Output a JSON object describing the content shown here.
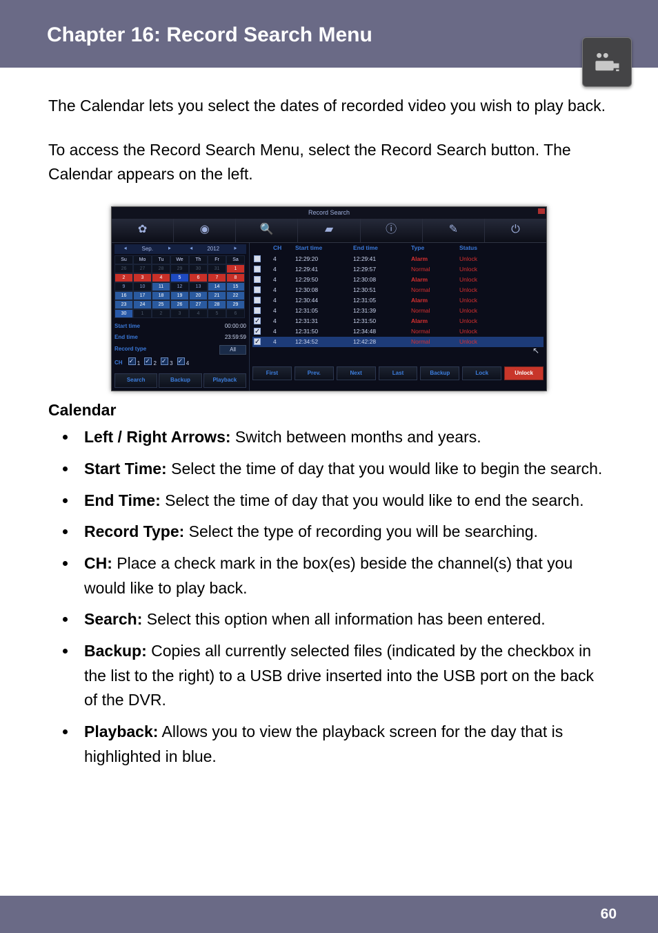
{
  "header": {
    "title": "Chapter 16: Record Search Menu",
    "icon": "recorder-icon"
  },
  "intro1": "The Calendar lets you select the dates of recorded video you wish to play back.",
  "intro2": "To access the Record Search Menu, select the Record Search button. The Calendar appears on the left.",
  "screenshot": {
    "title": "Record Search",
    "month_label": "Sep.",
    "year_label": "2012",
    "day_headers": [
      "Su",
      "Mo",
      "Tu",
      "We",
      "Th",
      "Fr",
      "Sa"
    ],
    "cal": [
      [
        {
          "d": "26",
          "c": "muted"
        },
        {
          "d": "27",
          "c": "muted"
        },
        {
          "d": "28",
          "c": "muted"
        },
        {
          "d": "29",
          "c": "muted"
        },
        {
          "d": "30",
          "c": "muted"
        },
        {
          "d": "31",
          "c": "muted"
        },
        {
          "d": "1",
          "c": "red"
        }
      ],
      [
        {
          "d": "2",
          "c": "red"
        },
        {
          "d": "3",
          "c": "red"
        },
        {
          "d": "4",
          "c": "red"
        },
        {
          "d": "5",
          "c": "blue"
        },
        {
          "d": "6",
          "c": "red"
        },
        {
          "d": "7",
          "c": "red"
        },
        {
          "d": "8",
          "c": "red"
        }
      ],
      [
        {
          "d": "9",
          "c": ""
        },
        {
          "d": "10",
          "c": ""
        },
        {
          "d": "11",
          "c": "mid"
        },
        {
          "d": "12",
          "c": ""
        },
        {
          "d": "13",
          "c": ""
        },
        {
          "d": "14",
          "c": "mid"
        },
        {
          "d": "15",
          "c": "mid"
        }
      ],
      [
        {
          "d": "16",
          "c": "mid"
        },
        {
          "d": "17",
          "c": "mid"
        },
        {
          "d": "18",
          "c": "mid"
        },
        {
          "d": "19",
          "c": "mid"
        },
        {
          "d": "20",
          "c": "mid"
        },
        {
          "d": "21",
          "c": "mid"
        },
        {
          "d": "22",
          "c": "mid"
        }
      ],
      [
        {
          "d": "23",
          "c": "mid"
        },
        {
          "d": "24",
          "c": "mid"
        },
        {
          "d": "25",
          "c": "mid"
        },
        {
          "d": "26",
          "c": "mid"
        },
        {
          "d": "27",
          "c": "mid"
        },
        {
          "d": "28",
          "c": "mid"
        },
        {
          "d": "29",
          "c": "mid"
        }
      ],
      [
        {
          "d": "30",
          "c": "hili"
        },
        {
          "d": "1",
          "c": "muted"
        },
        {
          "d": "2",
          "c": "muted"
        },
        {
          "d": "3",
          "c": "muted"
        },
        {
          "d": "4",
          "c": "muted"
        },
        {
          "d": "5",
          "c": "muted"
        },
        {
          "d": "6",
          "c": "muted"
        }
      ]
    ],
    "left": {
      "start_time_label": "Start time",
      "start_time_value": "00:00:00",
      "end_time_label": "End time",
      "end_time_value": "23:59:59",
      "record_type_label": "Record type",
      "record_type_value": "All",
      "ch_label": "CH",
      "ch_boxes": [
        "1",
        "2",
        "3",
        "4"
      ],
      "buttons": [
        "Search",
        "Backup",
        "Playback"
      ]
    },
    "table": {
      "headers": [
        "",
        "CH",
        "Start time",
        "End time",
        "Type",
        "Status"
      ],
      "rows": [
        {
          "ck": false,
          "ch": "4",
          "st": "12:29:20",
          "et": "12:29:41",
          "ty": "Alarm",
          "tyc": "ty-red",
          "ss": "Unlock"
        },
        {
          "ck": false,
          "ch": "4",
          "st": "12:29:41",
          "et": "12:29:57",
          "ty": "Normal",
          "tyc": "ty-norm",
          "ss": "Unlock"
        },
        {
          "ck": false,
          "ch": "4",
          "st": "12:29:50",
          "et": "12:30:08",
          "ty": "Alarm",
          "tyc": "ty-red",
          "ss": "Unlock"
        },
        {
          "ck": false,
          "ch": "4",
          "st": "12:30:08",
          "et": "12:30:51",
          "ty": "Normal",
          "tyc": "ty-norm",
          "ss": "Unlock"
        },
        {
          "ck": false,
          "ch": "4",
          "st": "12:30:44",
          "et": "12:31:05",
          "ty": "Alarm",
          "tyc": "ty-red",
          "ss": "Unlock"
        },
        {
          "ck": false,
          "ch": "4",
          "st": "12:31:05",
          "et": "12:31:39",
          "ty": "Normal",
          "tyc": "ty-norm",
          "ss": "Unlock"
        },
        {
          "ck": true,
          "ch": "4",
          "st": "12:31:31",
          "et": "12:31:50",
          "ty": "Alarm",
          "tyc": "ty-red",
          "ss": "Unlock"
        },
        {
          "ck": true,
          "ch": "4",
          "st": "12:31:50",
          "et": "12:34:48",
          "ty": "Normal",
          "tyc": "ty-norm",
          "ss": "Unlock"
        },
        {
          "ck": true,
          "ch": "4",
          "st": "12:34:52",
          "et": "12:42:28",
          "ty": "Normal",
          "tyc": "ty-norm",
          "ss": "Unlock",
          "sel": true
        }
      ],
      "buttons": [
        "First",
        "Prev.",
        "Next",
        "Last",
        "Backup",
        "Lock",
        "Unlock"
      ]
    }
  },
  "calendar_heading": "Calendar",
  "bullets": [
    {
      "b": "Left / Right Arrows:",
      "t": " Switch between months and years."
    },
    {
      "b": "Start Time:",
      "t": " Select the time of day that you would like to begin the search."
    },
    {
      "b": "End Time:",
      "t": " Select the time of day that you would like to end the search."
    },
    {
      "b": "Record Type:",
      "t": " Select the type of recording you will be searching."
    },
    {
      "b": "CH:",
      "t": " Place a check mark in the box(es) beside the channel(s) that you would like to play back."
    },
    {
      "b": "Search:",
      "t": " Select this option when all information has been entered."
    },
    {
      "b": "Backup:",
      "t": " Copies all currently selected files (indicated by the checkbox in the list to the right) to a USB drive inserted into the USB port on the back of the DVR."
    },
    {
      "b": "Playback:",
      "t": " Allows you to view the playback screen for the day that is highlighted in blue."
    }
  ],
  "footer": {
    "page_number": "60"
  }
}
